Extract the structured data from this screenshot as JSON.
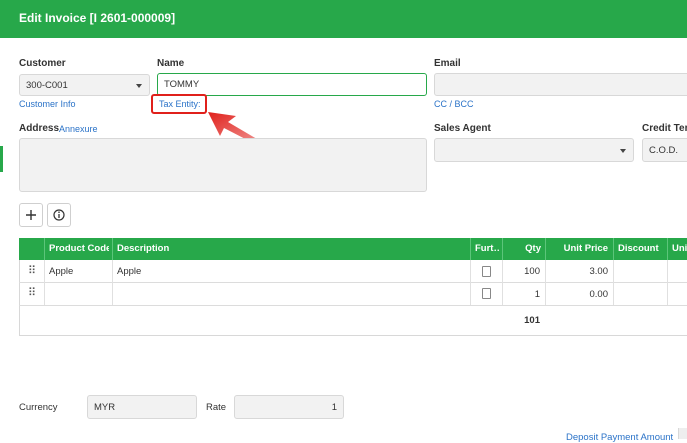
{
  "header": {
    "title": "Edit Invoice [I 2601-000009]"
  },
  "customer": {
    "label": "Customer",
    "value": "300-C001",
    "info_link": "Customer Info"
  },
  "name": {
    "label": "Name",
    "value": "TOMMY",
    "tax_entity_link": "Tax Entity:"
  },
  "email": {
    "label": "Email",
    "value": "",
    "cc_link": "CC / BCC"
  },
  "address": {
    "label": "Address",
    "annexure_link": "Annexure",
    "value": ""
  },
  "sales_agent": {
    "label": "Sales Agent",
    "value": ""
  },
  "credit_term": {
    "label": "Credit Term",
    "value": "C.O.D."
  },
  "toolbar": {
    "add_icon": "plus-icon",
    "info_icon": "info-icon"
  },
  "table": {
    "columns": [
      "Product Code",
      "Description",
      "Furt…",
      "Qty",
      "Unit Price",
      "Discount",
      "Unit"
    ],
    "rows": [
      {
        "product_code": "Apple",
        "description": "Apple",
        "qty": "100",
        "unit_price": "3.00"
      },
      {
        "product_code": "",
        "description": "",
        "qty": "1",
        "unit_price": "0.00"
      }
    ],
    "total_qty": "101"
  },
  "footer": {
    "currency_label": "Currency",
    "currency_value": "MYR",
    "rate_label": "Rate",
    "rate_value": "1",
    "deposit_link": "Deposit Payment Amount"
  },
  "colors": {
    "brand_green": "#27a84a",
    "highlight_red": "#e0201b",
    "link_blue": "#2b73c8"
  }
}
